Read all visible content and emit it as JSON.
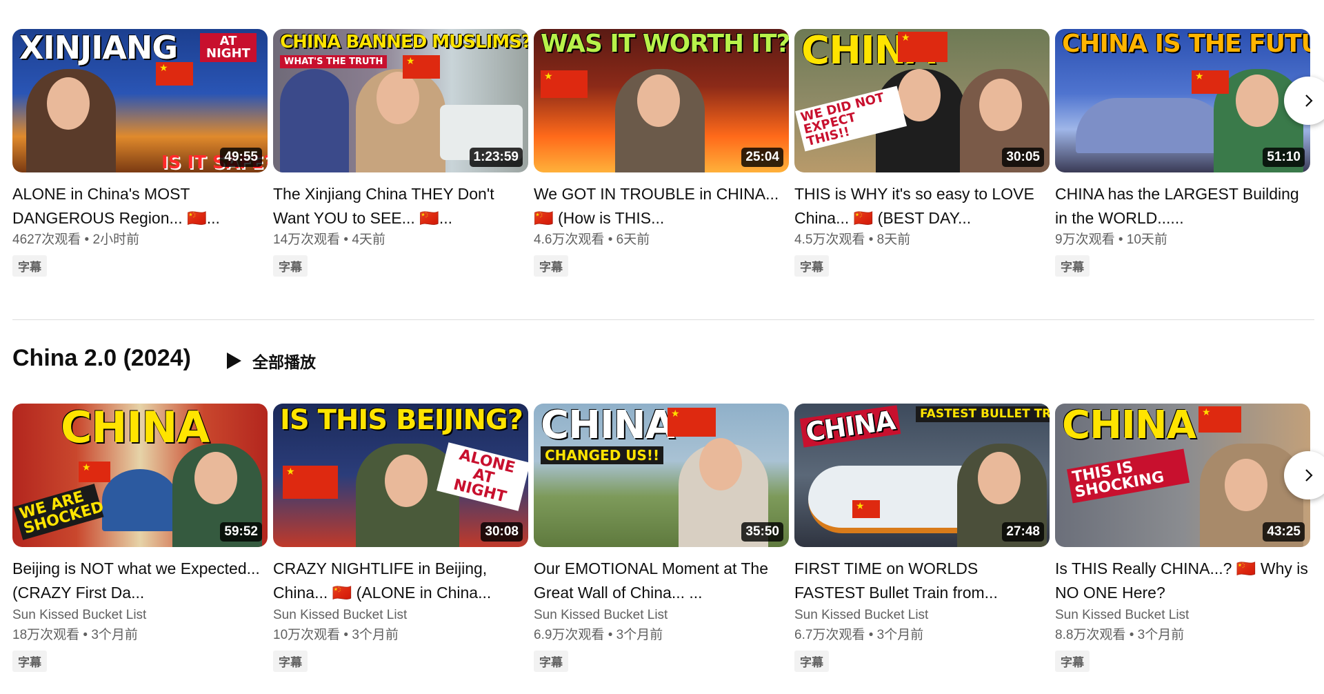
{
  "row1": [
    {
      "headline": "XINJIANG",
      "headline_color": "#ffffff",
      "sub": "AT NIGHT",
      "sub2": "IS IT SAFE?",
      "duration": "49:55",
      "title": "ALONE in China's MOST DANGEROUS Region... 🇨🇳...",
      "views": "4627次观看",
      "time": "2小时前",
      "badge": "字幕",
      "bg": "#1c3f8f",
      "bg2": "#e08a2c"
    },
    {
      "headline": "CHINA BANNED MUSLIMS?",
      "headline_color": "#ffe400",
      "sub": "WHAT'S THE TRUTH",
      "duration": "1:23:59",
      "title": "The Xinjiang China THEY Don't Want YOU to SEE... 🇨🇳...",
      "views": "14万次观看",
      "time": "4天前",
      "badge": "字幕",
      "bg": "#6f6a78",
      "bg2": "#c9d4d8"
    },
    {
      "headline": "WAS IT WORTH IT?",
      "headline_color": "#b8f24a",
      "duration": "25:04",
      "title": "We GOT IN TROUBLE in CHINA... 🇨🇳 (How is THIS...",
      "views": "4.6万次观看",
      "time": "6天前",
      "badge": "字幕",
      "bg": "#5a1a14",
      "bg2": "#ff6a1a"
    },
    {
      "headline": "CHINA",
      "headline_color": "#ffe400",
      "sub": "WE DID NOT EXPECT THIS!!",
      "duration": "30:05",
      "title": "THIS is WHY it's so easy to LOVE China... 🇨🇳 (BEST DAY...",
      "views": "4.5万次观看",
      "time": "8天前",
      "badge": "字幕",
      "bg": "#6e7a55",
      "bg2": "#b89a6a"
    },
    {
      "headline": "CHINA IS THE FUTURE",
      "headline_color": "#ffb400",
      "duration": "51:10",
      "title": "CHINA has the LARGEST Building in the WORLD......",
      "views": "9万次观看",
      "time": "10天前",
      "badge": "字幕",
      "bg": "#2a4fb0",
      "bg2": "#9fb6e8"
    }
  ],
  "section": {
    "title": "China 2.0 (2024)",
    "play_all": "全部播放"
  },
  "row2": [
    {
      "headline": "CHINA",
      "headline_color": "#ffe400",
      "sub": "WE ARE SHOCKED",
      "duration": "59:52",
      "title": "Beijing is NOT what we Expected... (CRAZY First Da...",
      "channel": "Sun Kissed Bucket List",
      "views": "18万次观看",
      "time": "3个月前",
      "badge": "字幕",
      "bg": "#b3261e",
      "bg2": "#e6d3a8"
    },
    {
      "headline": "IS THIS BEIJING?",
      "headline_color": "#ffe400",
      "sub": "ALONE AT NIGHT",
      "duration": "30:08",
      "title": "CRAZY NIGHTLIFE in Beijing, China... 🇨🇳 (ALONE in China...",
      "channel": "Sun Kissed Bucket List",
      "views": "10万次观看",
      "time": "3个月前",
      "badge": "字幕",
      "bg": "#1b2a5a",
      "bg2": "#c03a2a"
    },
    {
      "headline": "CHINA",
      "headline_color": "#ffffff",
      "sub": "CHANGED US!!",
      "duration": "35:50",
      "title": "Our EMOTIONAL Moment at The Great Wall of China... ...",
      "channel": "Sun Kissed Bucket List",
      "views": "6.9万次观看",
      "time": "3个月前",
      "badge": "字幕",
      "bg": "#8fb0c9",
      "bg2": "#5f7a3e"
    },
    {
      "headline": "CHINA",
      "headline_color": "#ffffff",
      "sub": "FASTEST BULLET TRAIN",
      "duration": "27:48",
      "title": "FIRST TIME on WORLDS FASTEST Bullet Train from...",
      "channel": "Sun Kissed Bucket List",
      "views": "6.7万次观看",
      "time": "3个月前",
      "badge": "字幕",
      "bg": "#3d4a5c",
      "bg2": "#e9eef2"
    },
    {
      "headline": "CHINA",
      "headline_color": "#ffe400",
      "sub": "THIS IS SHOCKING",
      "duration": "43:25",
      "title": "Is THIS Really CHINA...? 🇨🇳 Why is NO ONE Here?",
      "channel": "Sun Kissed Bucket List",
      "views": "8.8万次观看",
      "time": "3个月前",
      "badge": "字幕",
      "bg": "#6b6f7a",
      "bg2": "#c2a07a"
    }
  ]
}
